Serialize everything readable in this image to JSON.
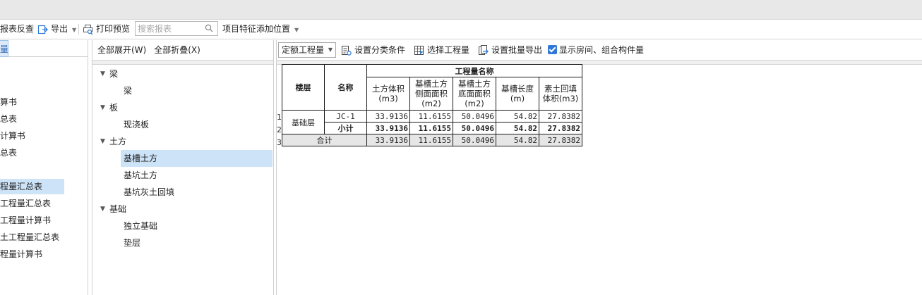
{
  "toolbar": {
    "report_check": "报表反查",
    "export": "导出",
    "print_preview": "打印预览",
    "search_placeholder": "搜索报表",
    "add_feature_position": "项目特征添加位置"
  },
  "left": {
    "tab_label": "量",
    "items": [
      "算书",
      "总表",
      "计算书",
      "总表",
      "程量汇总表",
      "工程量汇总表",
      "工程量计算书",
      "土工程量汇总表",
      "程量计算书"
    ]
  },
  "middle": {
    "expand_all": "全部展开(W)",
    "collapse_all": "全部折叠(X)",
    "tree": [
      {
        "label": "梁",
        "children": [
          "梁"
        ]
      },
      {
        "label": "板",
        "children": [
          "现浇板"
        ]
      },
      {
        "label": "土方",
        "children": [
          "基槽土方",
          "基坑土方",
          "基坑灰土回填"
        ]
      },
      {
        "label": "基础",
        "children": [
          "独立基础",
          "垫层"
        ]
      }
    ],
    "selected": "基槽土方"
  },
  "right_toolbar": {
    "quota_select": "定额工程量",
    "set_category": "设置分类条件",
    "select_quantity": "选择工程量",
    "set_batch_export": "设置批量导出",
    "show_rooms": "显示房间、组合构件量"
  },
  "report": {
    "header_group": "工程量名称",
    "col_floor": "楼层",
    "col_name": "名称",
    "cols": [
      "土方体积(m3)",
      "基槽土方侧面面积(m2)",
      "基槽土方底面面积(m2)",
      "基槽长度(m)",
      "素土回填体积(m3)"
    ],
    "row_numbers": [
      "1",
      "2",
      "3"
    ],
    "floor": "基础层",
    "rows": [
      {
        "name": "JC-1",
        "values": [
          "33.9136",
          "11.6155",
          "50.0496",
          "54.82",
          "27.8382"
        ]
      },
      {
        "name": "小计",
        "values": [
          "33.9136",
          "11.6155",
          "50.0496",
          "54.82",
          "27.8382"
        ]
      }
    ],
    "total": {
      "label": "合计",
      "values": [
        "33.9136",
        "11.6155",
        "50.0496",
        "54.82",
        "27.8382"
      ]
    }
  },
  "colors": {
    "accent": "#2f7ad9",
    "selection": "#cde3f8"
  }
}
